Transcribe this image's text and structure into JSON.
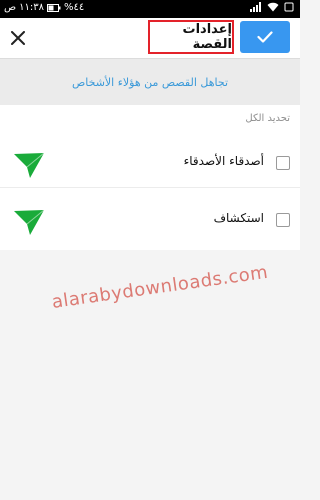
{
  "status_bar": {
    "carrier_text": "ص",
    "time": "١١:٣٨",
    "battery_level": "%٤٤"
  },
  "header": {
    "title": "إعدادات القصة",
    "close_icon": "close-icon",
    "confirm_icon": "checkmark-icon",
    "confirm_bg": "#3897f0",
    "highlight_border": "#e3222a"
  },
  "banner": {
    "text": "تجاهل القصص من هؤلاء الأشخاص",
    "color": "#3b9ad9"
  },
  "list": {
    "select_all_label": "تحديد الكل",
    "items": [
      {
        "label": "أصدقاء الأصدقاء",
        "checked": false,
        "icon": "send-icon"
      },
      {
        "label": "استكشاف",
        "checked": false,
        "icon": "send-icon"
      }
    ],
    "icon_color": "#1aab3a"
  },
  "watermark": {
    "text": "alarabydownloads.com"
  }
}
